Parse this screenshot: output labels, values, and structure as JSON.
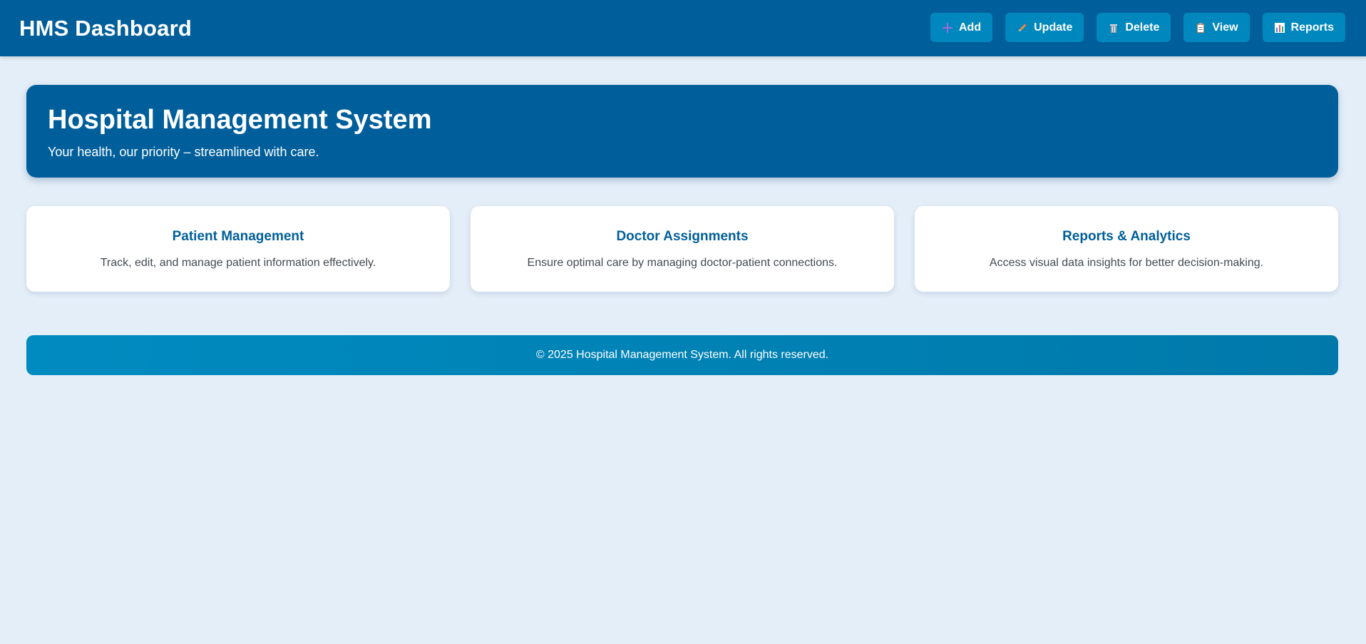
{
  "header": {
    "brand": "HMS Dashboard",
    "actions": [
      {
        "label": "Add",
        "icon": "plus-icon"
      },
      {
        "label": "Update",
        "icon": "pencil-icon"
      },
      {
        "label": "Delete",
        "icon": "trash-icon"
      },
      {
        "label": "View",
        "icon": "clipboard-icon"
      },
      {
        "label": "Reports",
        "icon": "bar-chart-icon"
      }
    ]
  },
  "hero": {
    "title": "Hospital Management System",
    "subtitle": "Your health, our priority – streamlined with care."
  },
  "cards": [
    {
      "title": "Patient Management",
      "text": "Track, edit, and manage patient information effectively."
    },
    {
      "title": "Doctor Assignments",
      "text": "Ensure optimal care by managing doctor-patient connections."
    },
    {
      "title": "Reports & Analytics",
      "text": "Access visual data insights for better decision-making."
    }
  ],
  "footer": {
    "text": "© 2025 Hospital Management System. All rights reserved."
  },
  "colors": {
    "primary": "#005f9b",
    "button": "#0087bd",
    "background": "#e4eef8",
    "card": "#ffffff"
  }
}
